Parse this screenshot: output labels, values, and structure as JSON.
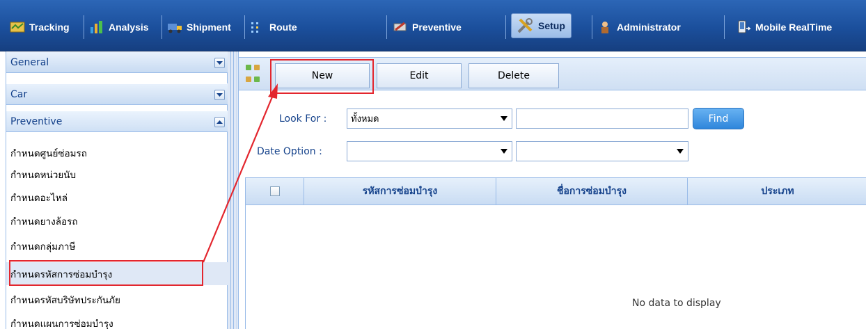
{
  "nav": {
    "items": [
      {
        "label": "Tracking",
        "icon": "tracking-icon"
      },
      {
        "label": "Analysis",
        "icon": "analysis-icon"
      },
      {
        "label": "Shipment",
        "icon": "shipment-icon"
      },
      {
        "label": "Route",
        "icon": "route-icon"
      },
      {
        "label": "Preventive",
        "icon": "preventive-icon"
      },
      {
        "label": "Setup",
        "icon": "setup-icon",
        "active": true
      },
      {
        "label": "Administrator",
        "icon": "administrator-icon"
      },
      {
        "label": "Mobile RealTime",
        "icon": "mobile-realtime-icon"
      }
    ]
  },
  "sidebar": {
    "sections": [
      {
        "label": "General",
        "expanded": false
      },
      {
        "label": "Car",
        "expanded": false
      },
      {
        "label": "Preventive",
        "expanded": true
      }
    ],
    "items": [
      "กำหนดศูนย์ซ่อมรถ",
      "กำหนดหน่วยนับ",
      "กำหนดอะไหล่",
      "กำหนดยางล้อรถ",
      "กำหนดกลุ่มภาษี",
      "กำหนดรหัสการซ่อมบำรุง",
      "กำหนดรหัสบริษัทประกันภัย",
      "กำหนดแผนการซ่อมบำรุง"
    ],
    "selected_index": 5
  },
  "toolbar": {
    "new_label": "New",
    "edit_label": "Edit",
    "delete_label": "Delete"
  },
  "search": {
    "look_for_label": "Look For :",
    "look_for_value": "ทั้งหมด",
    "keyword_value": "",
    "find_label": "Find",
    "date_option_label": "Date Option :",
    "date_option_value": "",
    "date_value": ""
  },
  "grid": {
    "columns": [
      "รหัสการซ่อมบำรุง",
      "ชื่อการซ่อมบำรุง",
      "ประเภท"
    ],
    "rows": [],
    "empty_text": "No data to display"
  },
  "colors": {
    "nav_bg": "#1b4f9c",
    "panel_text": "#15428b",
    "border": "#99bbe8",
    "highlight": "#e3262e",
    "find_button": "#3b8fe0"
  }
}
